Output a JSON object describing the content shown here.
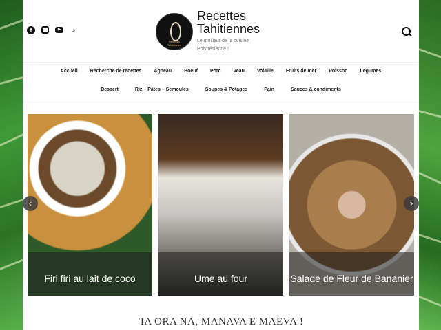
{
  "header": {
    "site_title": "Recettes Tahitiennes",
    "tagline": "Le meilleur de la cuisine Polynésienne !",
    "logo_text": "Recettes Tahitiennes",
    "social_icons": [
      "facebook-icon",
      "instagram-icon",
      "youtube-icon",
      "tiktok-icon"
    ]
  },
  "nav": {
    "row1": [
      "Accueil",
      "Recherche de recettes",
      "Agneau",
      "Boeuf",
      "Porc",
      "Veau",
      "Volaille",
      "Fruits de mer",
      "Poisson",
      "Légumes"
    ],
    "row2": [
      "Dessert",
      "Riz – Pâtes – Semoules",
      "Soupes & Potages",
      "Pain",
      "Sauces & condiments"
    ]
  },
  "slider": {
    "cards": [
      {
        "caption": "Firi firi au lait de coco"
      },
      {
        "caption": "Ume au four"
      },
      {
        "caption": "Salade de Fleur de Bananier"
      }
    ],
    "prev_label": "‹",
    "next_label": "›"
  },
  "welcome": "'IA ORA NA, MANAVA E MAEVA !",
  "colors": {
    "accent": "#111111",
    "leaf_green": "#3f9a36",
    "caption_bg": "#2a2a2a"
  }
}
